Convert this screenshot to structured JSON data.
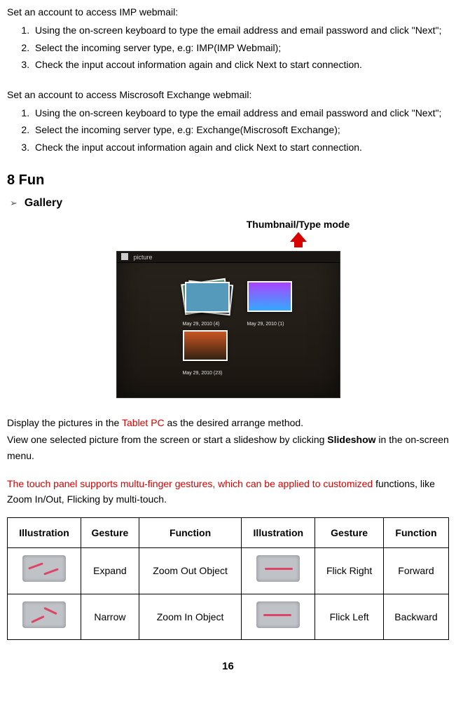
{
  "imp": {
    "intro": "Set an account to access IMP webmail:",
    "steps": [
      "Using the on-screen keyboard to type the email address and email password and click \"Next\";",
      "Select the incoming server type, e.g: IMP(IMP Webmail);",
      "Check the input accout information again and click Next to start connection."
    ]
  },
  "exchange": {
    "intro": "Set an account to access Miscrosoft Exchange webmail:",
    "steps": [
      "Using the on-screen keyboard to type the email address and email password and click \"Next\";",
      "Select the incoming server type, e.g: Exchange(Miscrosoft Exchange);",
      "Check the input accout information again and click Next to start connection."
    ]
  },
  "fun": {
    "heading": "8 Fun",
    "gallery": "Gallery",
    "thumb_label": "Thumbnail/Type mode"
  },
  "screenshot": {
    "bar": "picture",
    "cap1": "May 29, 2010 (4)",
    "cap2": "May 29, 2010 (1)",
    "cap3": "May 29, 2010 (23)"
  },
  "body": {
    "p1a": "Display the pictures in the ",
    "p1b": "Tablet PC",
    "p1c": " as the desired arrange method.",
    "p2a": "View one selected picture from the screen or start a slideshow by clicking ",
    "p2b": "Slideshow",
    "p2c": " in the on-screen menu.",
    "p3a": "The touch panel supports multu-finger gestures, which can be applied to customized",
    "p3b": " functions, like Zoom In/Out, Flicking by multi-touch."
  },
  "table": {
    "headers": [
      "Illustration",
      "Gesture",
      "Function",
      "Illustration",
      "Gesture",
      "Function"
    ],
    "rows": [
      {
        "g1": "Expand",
        "f1": "Zoom Out Object",
        "g2": "Flick Right",
        "f2": "Forward"
      },
      {
        "g1": "Narrow",
        "f1": "Zoom In Object",
        "g2": "Flick Left",
        "f2": "Backward"
      }
    ]
  },
  "page_number": "16"
}
